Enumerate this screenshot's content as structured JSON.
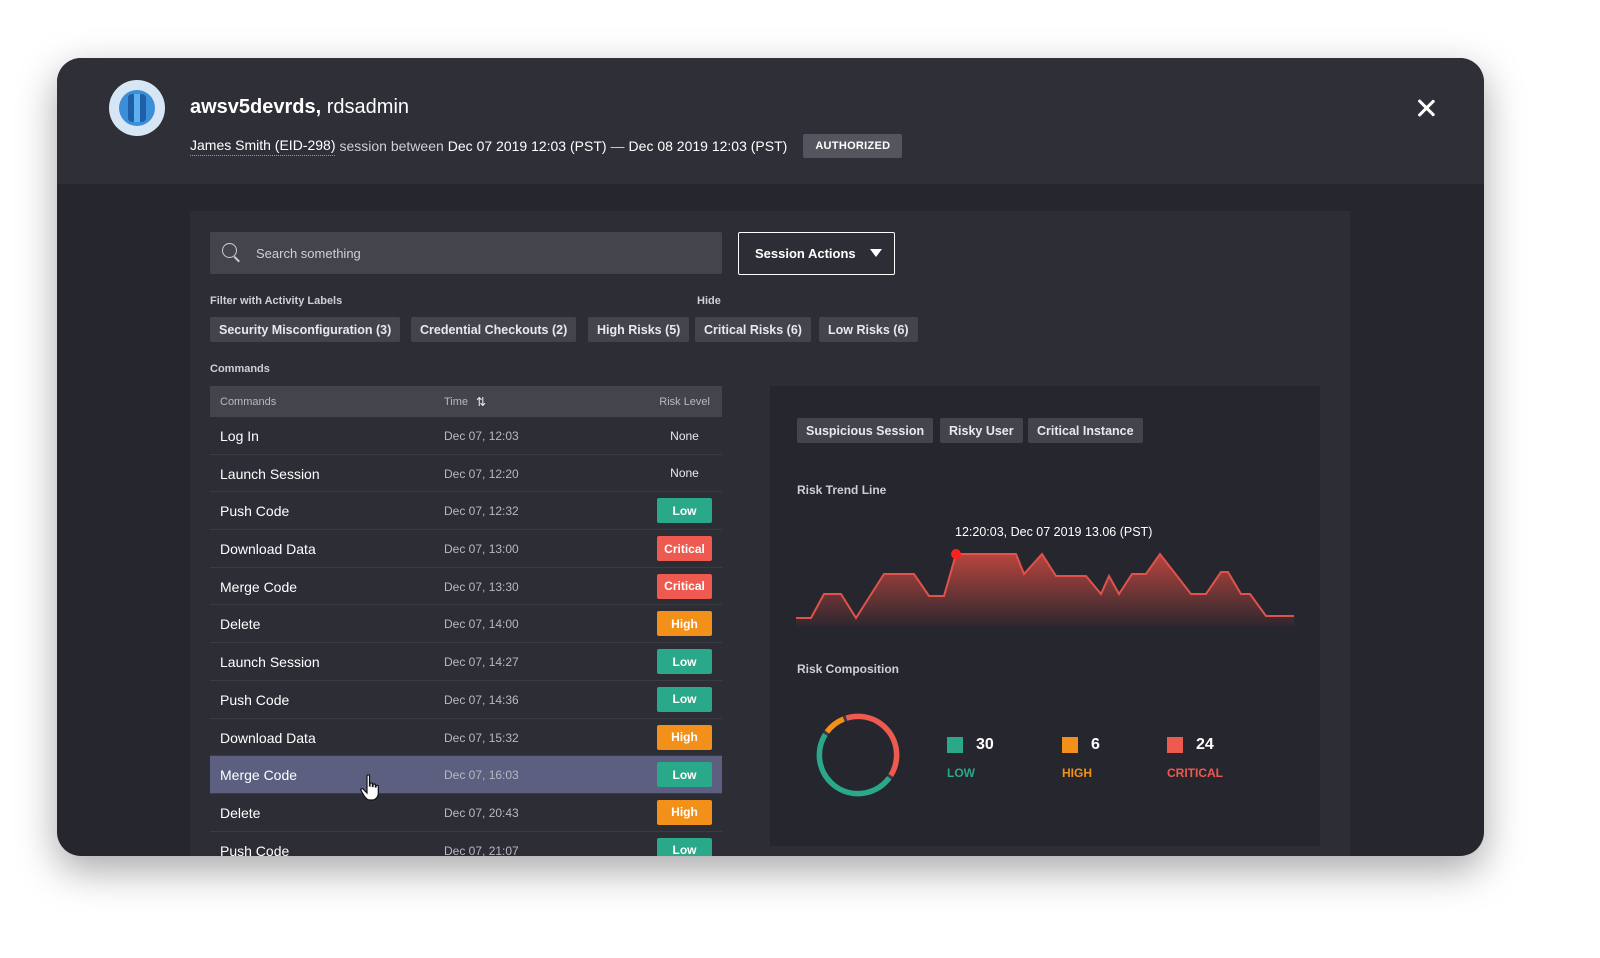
{
  "header": {
    "instance": "awsv5devrds,",
    "account": "rdsadmin",
    "user": "James Smith (EID-298)",
    "session_text": "session between",
    "start": "Dec 07 2019 12:03 (PST)",
    "dash": "—",
    "end": "Dec 08 2019 12:03 (PST)",
    "status_badge": "AUTHORIZED",
    "avatar_icon": "database-icon",
    "close_icon": "close-icon"
  },
  "search": {
    "placeholder": "Search something",
    "value": ""
  },
  "session_actions": {
    "label": "Session Actions"
  },
  "filters": {
    "title": "Filter with Activity Labels",
    "hide_label": "Hide",
    "chips": [
      "Security Misconfiguration (3)",
      "Credential Checkouts (2)",
      "High Risks (5)",
      "Critical Risks (6)",
      "Low Risks (6)"
    ]
  },
  "commands": {
    "title": "Commands",
    "columns": [
      "Commands",
      "Time",
      "Risk Level"
    ],
    "sort_icon": "sort-arrows-icon",
    "rows": [
      {
        "command": "Log In",
        "time": "Dec 07, 12:03",
        "risk": "None"
      },
      {
        "command": "Launch Session",
        "time": "Dec 07, 12:20",
        "risk": "None"
      },
      {
        "command": "Push Code",
        "time": "Dec 07, 12:32",
        "risk": "Low"
      },
      {
        "command": "Download Data",
        "time": "Dec 07, 13:00",
        "risk": "Critical"
      },
      {
        "command": "Merge Code",
        "time": "Dec 07, 13:30",
        "risk": "Critical"
      },
      {
        "command": "Delete",
        "time": "Dec 07, 14:00",
        "risk": "High"
      },
      {
        "command": "Launch Session",
        "time": "Dec 07, 14:27",
        "risk": "Low"
      },
      {
        "command": "Push Code",
        "time": "Dec 07, 14:36",
        "risk": "Low"
      },
      {
        "command": "Download Data",
        "time": "Dec 07, 15:32",
        "risk": "High"
      },
      {
        "command": "Merge Code",
        "time": "Dec 07, 16:03",
        "risk": "Low",
        "selected": true
      },
      {
        "command": "Delete",
        "time": "Dec 07, 20:43",
        "risk": "High"
      },
      {
        "command": "Push Code",
        "time": "Dec 07, 21:07",
        "risk": "Low"
      }
    ]
  },
  "insights": {
    "tags": [
      "Suspicious Session",
      "Risky User",
      "Critical Instance"
    ],
    "trend_title": "Risk Trend Line",
    "trend_annotation": "12:20:03, Dec 07 2019 13.06 (PST)",
    "composition_title": "Risk Composition",
    "composition": [
      {
        "value": "30",
        "label": "LOW",
        "color": "#2aa88a"
      },
      {
        "value": "6",
        "label": "HIGH",
        "color": "#f39019"
      },
      {
        "value": "24",
        "label": "CRITICAL",
        "color": "#ee5a4f"
      }
    ]
  },
  "colors": {
    "low": "#2aa88a",
    "high": "#f39019",
    "critical": "#ee5a4f",
    "trend_line": "#e0524a",
    "marker": "#ff1f1f"
  }
}
